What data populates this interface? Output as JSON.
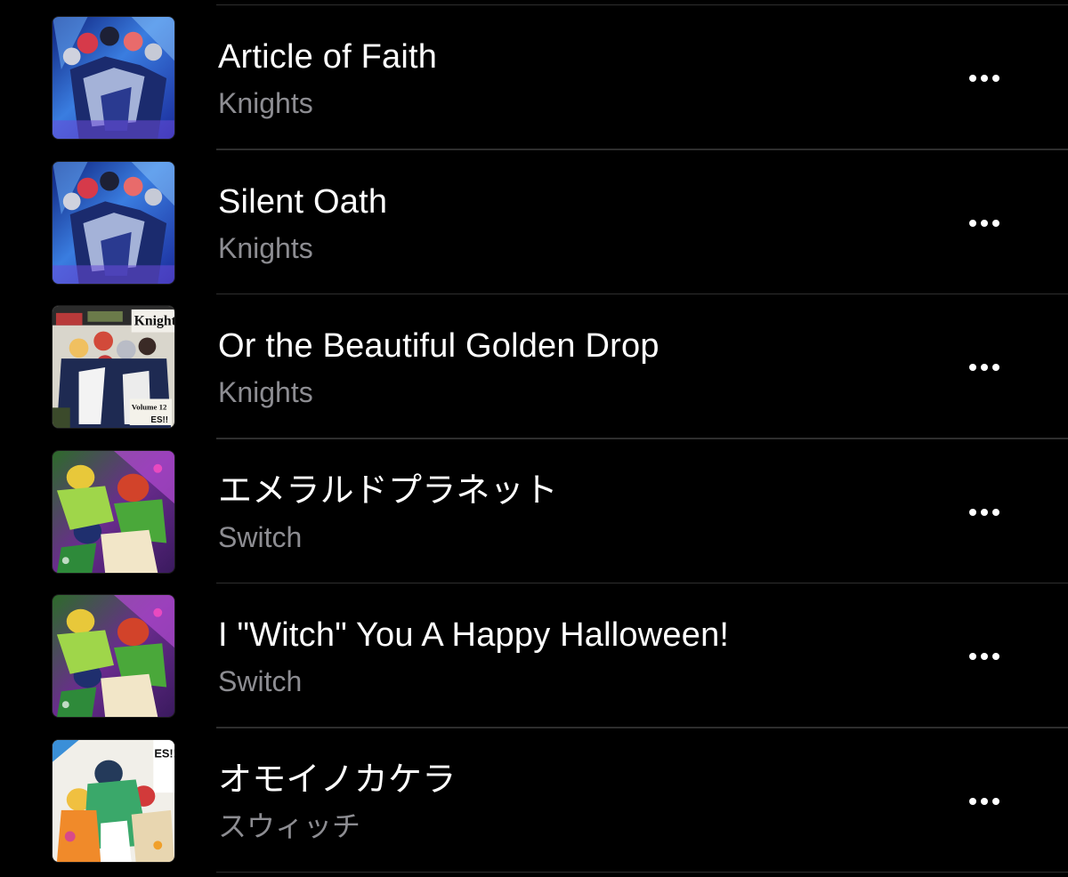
{
  "tracks": [
    {
      "title": "Article of Faith",
      "artist": "Knights",
      "artwork": "knights-blue-stage-art",
      "more_icon": "more-horizontal-icon"
    },
    {
      "title": "Silent Oath",
      "artist": "Knights",
      "artwork": "knights-blue-stage-art",
      "more_icon": "more-horizontal-icon"
    },
    {
      "title": "Or the Beautiful Golden Drop",
      "artist": "Knights",
      "artwork": "knights-newspaper-art",
      "artwork_text": [
        "Knight",
        "Volume 12",
        "ES!!"
      ],
      "more_icon": "more-horizontal-icon"
    },
    {
      "title": "エメラルドプラネット",
      "artist": "Switch",
      "artwork": "switch-green-magic-art",
      "more_icon": "more-horizontal-icon"
    },
    {
      "title": "I \"Witch\" You A Happy Halloween!",
      "artist": "Switch",
      "artwork": "switch-green-magic-art",
      "more_icon": "more-horizontal-icon"
    },
    {
      "title": "オモイノカケラ",
      "artist": "スウィッチ",
      "artwork": "switch-white-colorful-art",
      "artwork_text": [
        "ES!!"
      ],
      "more_icon": "more-horizontal-icon"
    }
  ],
  "colors": {
    "background": "#000000",
    "title": "#ffffff",
    "artist": "#8d8d92",
    "divider": "#2e2e2e"
  }
}
